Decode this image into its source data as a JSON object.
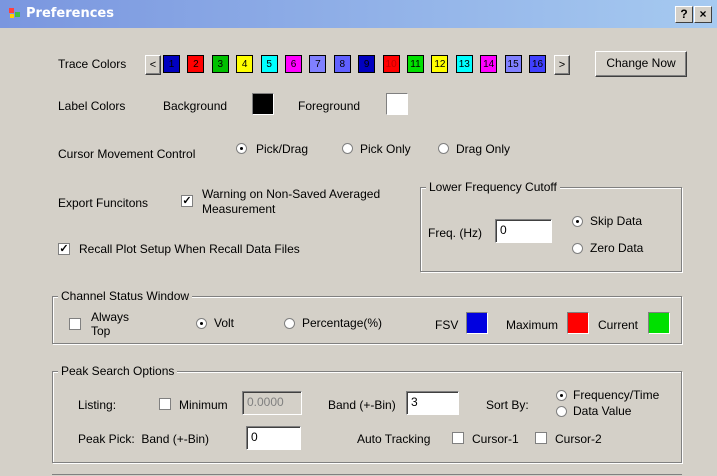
{
  "window": {
    "title": "Preferences",
    "help": "?",
    "close": "×"
  },
  "trace_colors": {
    "label": "Trace Colors",
    "prev": "<",
    "next": ">",
    "change_button": "Change Now",
    "swatches": [
      {
        "n": "1",
        "color": "#0000c0",
        "text": "#000000"
      },
      {
        "n": "2",
        "color": "#ff0000",
        "text": "#000000"
      },
      {
        "n": "3",
        "color": "#00c000",
        "text": "#000000"
      },
      {
        "n": "4",
        "color": "#ffff00",
        "text": "#000000"
      },
      {
        "n": "5",
        "color": "#00ffff",
        "text": "#000000"
      },
      {
        "n": "6",
        "color": "#ff00ff",
        "text": "#000000"
      },
      {
        "n": "7",
        "color": "#8080ff",
        "text": "#000000"
      },
      {
        "n": "8",
        "color": "#6060ff",
        "text": "#000000"
      },
      {
        "n": "9",
        "color": "#0000c0",
        "text": "#000000"
      },
      {
        "n": "10",
        "color": "#ff0000",
        "text": "#c00000"
      },
      {
        "n": "11",
        "color": "#00e000",
        "text": "#000000"
      },
      {
        "n": "12",
        "color": "#ffff00",
        "text": "#000000"
      },
      {
        "n": "13",
        "color": "#00ffff",
        "text": "#000000"
      },
      {
        "n": "14",
        "color": "#ff00ff",
        "text": "#000000"
      },
      {
        "n": "15",
        "color": "#8080ff",
        "text": "#000000"
      },
      {
        "n": "16",
        "color": "#4040ff",
        "text": "#000000"
      }
    ]
  },
  "label_colors": {
    "label": "Label Colors",
    "background_label": "Background",
    "background_color": "#000000",
    "foreground_label": "Foreground",
    "foreground_color": "#ffffff"
  },
  "cursor": {
    "label": "Cursor Movement Control",
    "options": [
      "Pick/Drag",
      "Pick Only",
      "Drag Only"
    ],
    "selected": 0
  },
  "export": {
    "label": "Export Funcitons",
    "warning": "Warning on Non-Saved Averaged Measurement",
    "warning_checked": true,
    "recall": "Recall Plot Setup When Recall Data Files",
    "recall_checked": true
  },
  "lower_freq": {
    "title": "Lower Frequency Cutoff",
    "freq_label": "Freq. (Hz)",
    "freq_value": "0",
    "options": [
      "Skip Data",
      "Zero Data"
    ],
    "selected": 0
  },
  "channel_status": {
    "title": "Channel Status Window",
    "always_top": "Always Top",
    "always_top_checked": false,
    "volt": "Volt",
    "percentage": "Percentage(%)",
    "unit_selected": 0,
    "fsv_label": "FSV",
    "fsv_color": "#0000e0",
    "maximum_label": "Maximum",
    "maximum_color": "#ff0000",
    "current_label": "Current",
    "current_color": "#00e000"
  },
  "peak_search": {
    "title": "Peak Search Options",
    "listing_label": "Listing:",
    "minimum_label": "Minimum",
    "minimum_checked": false,
    "minimum_value": "0.0000",
    "band_label": "Band (+-Bin)",
    "band_value": "3",
    "sort_label": "Sort By:",
    "sort_options": [
      "Frequency/Time",
      "Data Value"
    ],
    "sort_selected": 0,
    "peak_pick_label": "Peak Pick:  Band (+-Bin)",
    "peak_pick_value": "0",
    "auto_tracking_label": "Auto Tracking",
    "cursor1_label": "Cursor-1",
    "cursor1_checked": false,
    "cursor2_label": "Cursor-2",
    "cursor2_checked": false
  }
}
